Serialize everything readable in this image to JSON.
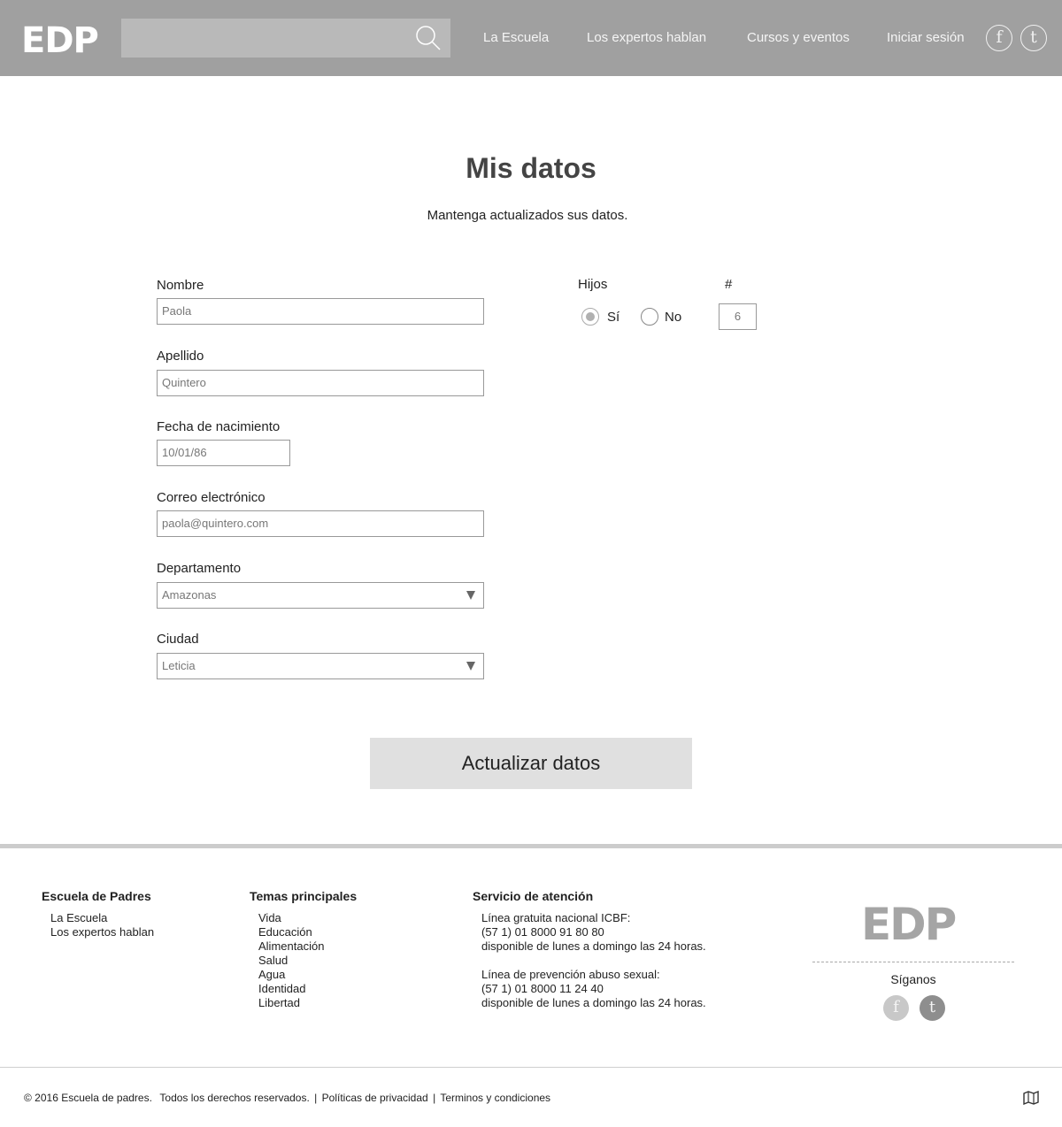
{
  "header": {
    "logo": "EDP",
    "search": {
      "placeholder": "",
      "icon": "search-icon"
    },
    "nav": [
      "La Escuela",
      "Los expertos hablan",
      "Cursos y eventos",
      "Iniciar sesión"
    ],
    "social": [
      "f",
      "t"
    ]
  },
  "page": {
    "title": "Mis datos",
    "subtitle": "Mantenga actualizados sus datos."
  },
  "form": {
    "nombre": {
      "label": "Nombre",
      "value": "Paola"
    },
    "apellido": {
      "label": "Apellido",
      "value": "Quintero"
    },
    "fecha": {
      "label": "Fecha de nacimiento",
      "value": "10/01/86"
    },
    "correo": {
      "label": "Correo electrónico",
      "value": "paola@quintero.com"
    },
    "departamento": {
      "label": "Departamento",
      "value": "Amazonas"
    },
    "ciudad": {
      "label": "Ciudad",
      "value": "Leticia"
    },
    "hijos": {
      "label": "Hijos",
      "options": [
        "Sí",
        "No"
      ],
      "selected": "Sí",
      "count_label": "#",
      "count": "6"
    },
    "submit": "Actualizar datos"
  },
  "footer": {
    "col1": {
      "title": "Escuela de Padres",
      "items": [
        "La Escuela",
        "Los expertos hablan"
      ]
    },
    "col2": {
      "title": "Temas principales",
      "items": [
        "Vida",
        "Educación",
        "Alimentación",
        "Salud",
        "Agua",
        "Identidad",
        "Libertad"
      ]
    },
    "col3": {
      "title": "Servicio de atención",
      "lines": [
        "Línea gratuita nacional ICBF:",
        "(57 1) 01 8000 91 80 80",
        "disponible de lunes a domingo las 24 horas.",
        "",
        "Línea de prevención abuso sexual:",
        "(57 1) 01 8000 11 24 40",
        "disponible de lunes a domingo las 24 horas."
      ]
    },
    "logo": "EDP",
    "follow": "Síganos",
    "social": [
      "f",
      "t"
    ],
    "legal": {
      "copyright": "© 2016 Escuela de padres.",
      "rights": "Todos los derechos reservados.",
      "privacy": "Políticas de privacidad",
      "terms": "Terminos y condiciones",
      "separator": "|"
    }
  },
  "colors": {
    "header_bg": "#a0a0a0",
    "search_bg": "#b9b9b9",
    "button_bg": "#e0e0e0",
    "footer_rule": "#cccccc"
  }
}
